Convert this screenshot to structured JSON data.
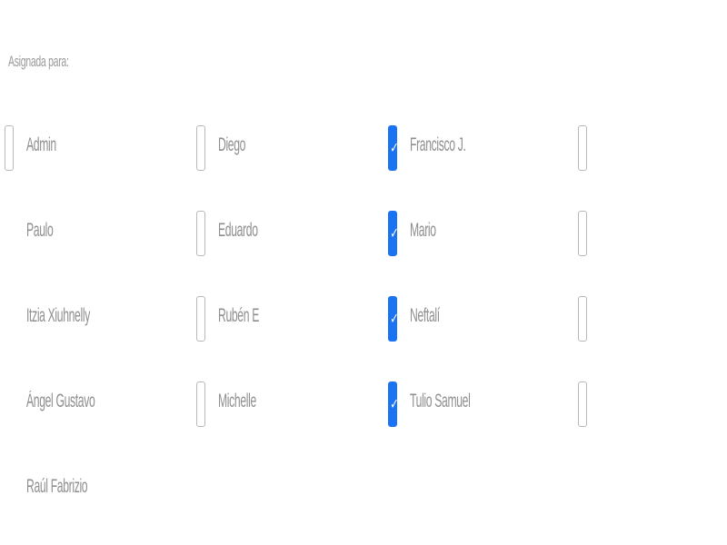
{
  "form": {
    "assigned_label": "Asignada para:",
    "accent_color": "#1a73f2"
  },
  "options": [
    {
      "label": "Admin",
      "checked": false
    },
    {
      "label": "Diego",
      "checked": false
    },
    {
      "label": "Francisco J.",
      "checked": true
    },
    {
      "label": "",
      "checked": false
    },
    {
      "label": "Paulo",
      "checked": false
    },
    {
      "label": "Eduardo",
      "checked": false
    },
    {
      "label": "Mario",
      "checked": true
    },
    {
      "label": "",
      "checked": false
    },
    {
      "label": "Itzia Xiuhnelly",
      "checked": false
    },
    {
      "label": "Rubén E",
      "checked": false
    },
    {
      "label": "Neftalí",
      "checked": true
    },
    {
      "label": "",
      "checked": false
    },
    {
      "label": "Ángel Gustavo",
      "checked": false
    },
    {
      "label": "Michelle",
      "checked": false
    },
    {
      "label": "Tulio Samuel",
      "checked": true
    },
    {
      "label": "",
      "checked": false
    },
    {
      "label": "Raúl Fabrizio",
      "checked": false
    }
  ]
}
